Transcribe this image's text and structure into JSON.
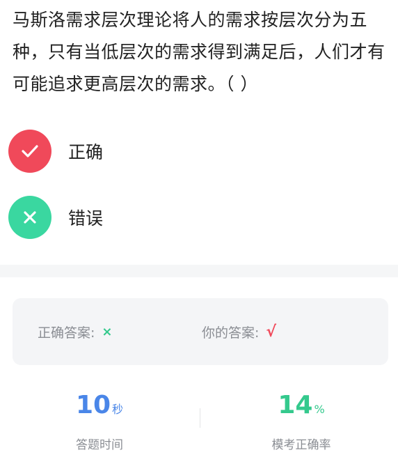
{
  "question": {
    "text": "马斯洛需求层次理论将人的需求按层次分为五种，只有当低层次的需求得到满足后，人们才有可能追求更高层次的需求。（    ）"
  },
  "options": [
    {
      "label": "正确",
      "icon": "check-icon",
      "color": "#f0495a"
    },
    {
      "label": "错误",
      "icon": "close-icon",
      "color": "#3ad7a0"
    }
  ],
  "answer": {
    "correct_label": "正确答案:",
    "correct_value": "×",
    "correct_color": "#34c98d",
    "yours_label": "你的答案:",
    "yours_value": "√",
    "yours_color": "#f0495a"
  },
  "stats": {
    "time_value": "10",
    "time_unit": "秒",
    "time_label": "答题时间",
    "time_color": "#4a86e8",
    "accuracy_value": "14",
    "accuracy_unit": "%",
    "accuracy_label": "模考正确率",
    "accuracy_color": "#34c98d"
  }
}
